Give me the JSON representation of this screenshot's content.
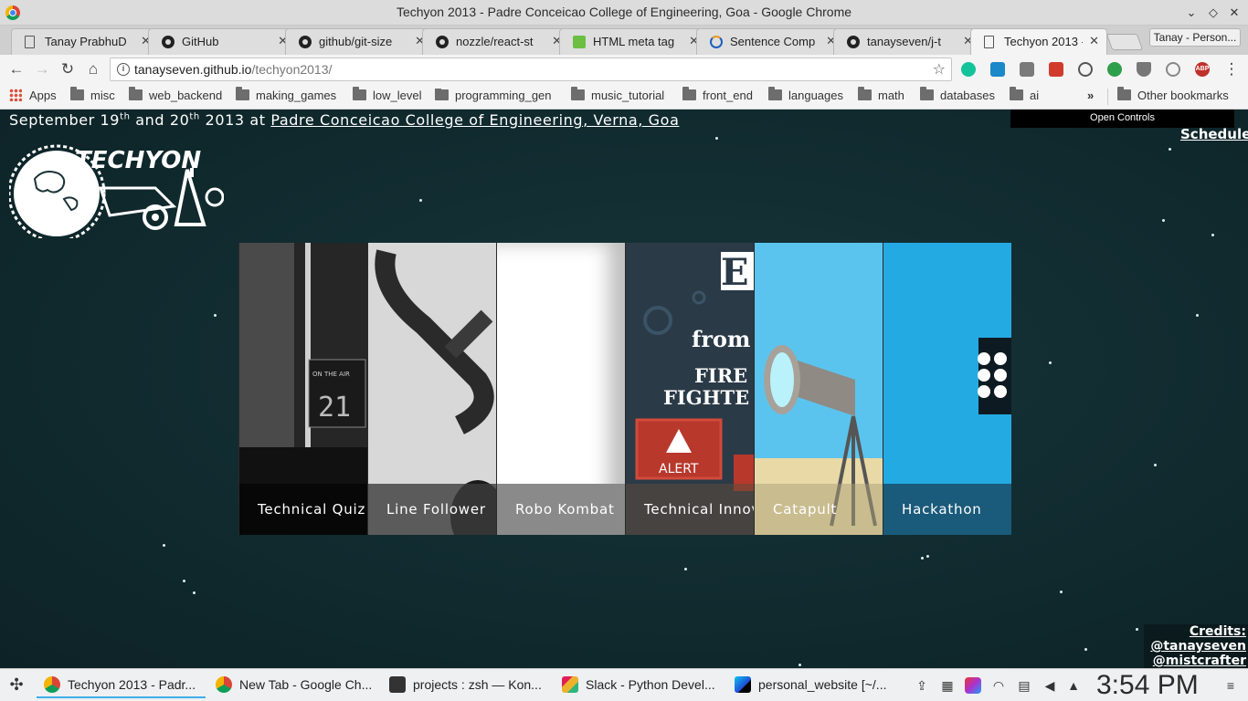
{
  "window": {
    "title": "Techyon 2013 - Padre Conceicao College of Engineering, Goa - Google Chrome"
  },
  "tabs": [
    {
      "label": "Tanay PrabhuD",
      "favicon": "doc"
    },
    {
      "label": "GitHub",
      "favicon": "github"
    },
    {
      "label": "github/git-size",
      "favicon": "github"
    },
    {
      "label": "nozzle/react-st",
      "favicon": "github"
    },
    {
      "label": "HTML meta tag",
      "favicon": "w3"
    },
    {
      "label": "Sentence Comp",
      "favicon": "scholar"
    },
    {
      "label": "tanayseven/j-t",
      "favicon": "github"
    },
    {
      "label": "Techyon 2013 -",
      "favicon": "doc"
    }
  ],
  "profile": {
    "label": "Tanay - Person..."
  },
  "omnibox": {
    "host": "tanayseven.github.io",
    "path": "/techyon2013/"
  },
  "bookmarks": [
    {
      "label": "Apps",
      "icon": "apps-grid-icon"
    },
    {
      "label": "misc",
      "icon": "folder-icon"
    },
    {
      "label": "web_backend",
      "icon": "folder-icon"
    },
    {
      "label": "making_games",
      "icon": "folder-icon"
    },
    {
      "label": "low_level",
      "icon": "folder-icon"
    },
    {
      "label": "programming_gen",
      "icon": "folder-icon"
    },
    {
      "label": "music_tutorial",
      "icon": "folder-icon"
    },
    {
      "label": "front_end",
      "icon": "folder-icon"
    },
    {
      "label": "languages",
      "icon": "folder-icon"
    },
    {
      "label": "math",
      "icon": "folder-icon"
    },
    {
      "label": "databases",
      "icon": "folder-icon"
    },
    {
      "label": "ai",
      "icon": "folder-icon"
    }
  ],
  "other_bookmarks": "Other bookmarks",
  "page": {
    "date_text_1": "September 19",
    "date_sup_1": "th",
    "date_text_2": " and 20",
    "date_sup_2": "th",
    "date_text_3": " 2013 at ",
    "venue_link": "Padre Conceicao College of Engineering, Verna, Goa",
    "open_controls": "Open Controls",
    "schedule_link": "Schedule",
    "logo_text": "TECHYON",
    "events": [
      {
        "caption": "Technical Quiz"
      },
      {
        "caption": "Line Follower"
      },
      {
        "caption": "Robo Kombat"
      },
      {
        "caption": "Technical Innov"
      },
      {
        "caption": "Catapult"
      },
      {
        "caption": "Hackathon"
      }
    ],
    "innov_panel_text": {
      "big": "E",
      "from": "from",
      "fire": "FIRE",
      "fighter": "FIGHTE",
      "alert": "ALERT"
    },
    "quiz_panel_text": {
      "on_air": "ON THE AIR",
      "number": "21"
    },
    "credits": [
      "Credits:",
      "@tanayseven",
      "@mistcrafter"
    ]
  },
  "taskbar": {
    "tasks": [
      {
        "label": "Techyon 2013 - Padr...",
        "icon": "chrome"
      },
      {
        "label": "New Tab - Google Ch...",
        "icon": "chrome"
      },
      {
        "label": "projects : zsh — Kon...",
        "icon": "terminal"
      },
      {
        "label": "Slack - Python Devel...",
        "icon": "slack"
      },
      {
        "label": "personal_website [~/...",
        "icon": "webstorm"
      }
    ],
    "clock": "3:54 PM"
  }
}
